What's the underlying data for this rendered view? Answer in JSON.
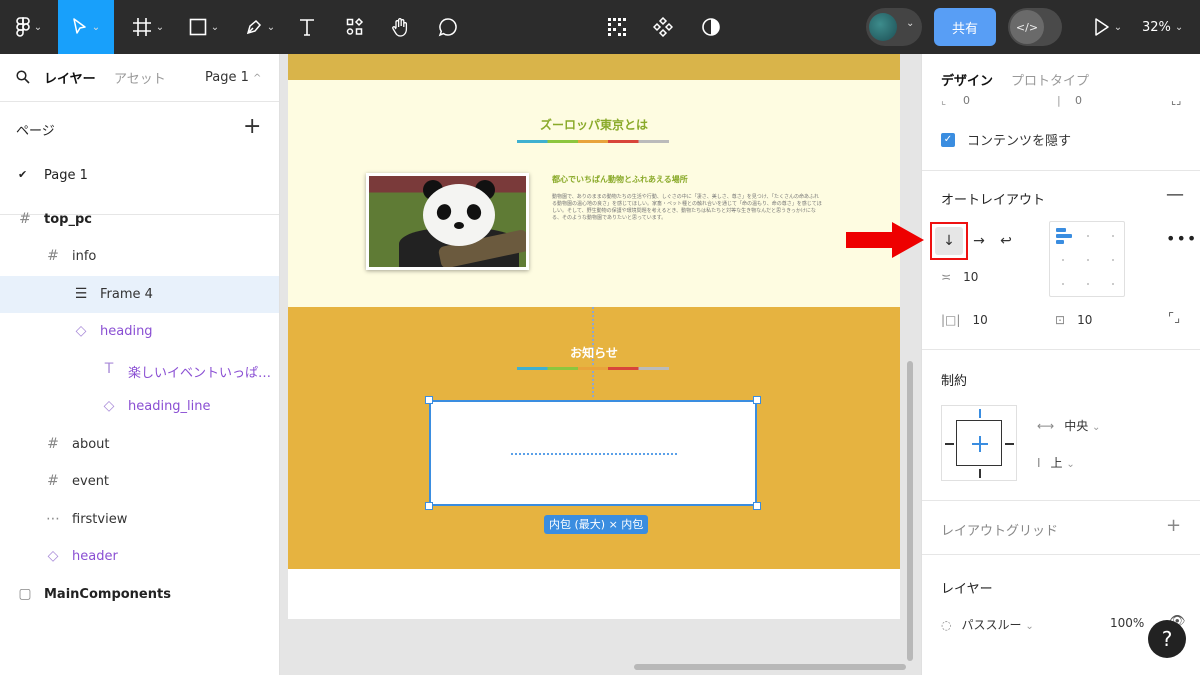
{
  "toolbar": {
    "share_label": "共有",
    "zoom_label": "32%",
    "colors": {
      "background": "#2c2c2c",
      "active_tool": "#18a0fb",
      "share": "#589ef5"
    }
  },
  "left_panel": {
    "tab_layers": "レイヤー",
    "tab_assets": "アセット",
    "page_selector": "Page 1",
    "pages_label": "ページ",
    "pages": [
      "Page 1"
    ],
    "layers": [
      {
        "name": "top_pc",
        "icon": "frame-icon",
        "depth": 0
      },
      {
        "name": "info",
        "icon": "frame-icon",
        "depth": 1
      },
      {
        "name": "Frame 4",
        "icon": "auto-layout-icon",
        "depth": 2,
        "selected": true
      },
      {
        "name": "heading",
        "icon": "component-instance-icon",
        "depth": 2
      },
      {
        "name": "楽しいイベントいっぱ…",
        "icon": "text-icon",
        "depth": 3
      },
      {
        "name": "heading_line",
        "icon": "component-instance-icon",
        "depth": 3
      },
      {
        "name": "about",
        "icon": "frame-icon",
        "depth": 1
      },
      {
        "name": "event",
        "icon": "frame-icon",
        "depth": 1
      },
      {
        "name": "firstview",
        "icon": "dashed-frame-icon",
        "depth": 1
      },
      {
        "name": "header",
        "icon": "component-instance-icon",
        "depth": 1
      },
      {
        "name": "MainComponents",
        "icon": "section-icon",
        "depth": 0
      }
    ]
  },
  "canvas": {
    "info_title": "ズーロッパ東京とは",
    "info_subtitle": "都心でいちばん動物とふれあえる場所",
    "info_body": "動物園で、ありのままの動物たちの生活や行動、しぐさの中に「凄さ、美しさ、尊さ」を見つけ、「たくさんの命あふれる動物園の温心地の良さ」を感じてほしい。家畜・ペット種との触れ合いを通じて「命の温もり、命の尊さ」を感じてほしい。そして、野生動物の保護や環境問題を考えるとき、動物たちは私たちと対等な生き物なんだと思うきっかけになる、そのような動物園でありたいと思っています。",
    "news_title": "お知らせ",
    "size_badge": "内包 (最大) × 内包"
  },
  "right_panel": {
    "tab_design": "デザイン",
    "tab_prototype": "プロトタイプ",
    "dim_values": [
      "0",
      "0"
    ],
    "clip_content_label": "コンテンツを隠す",
    "auto_layout_title": "オートレイアウト",
    "auto_layout": {
      "direction": "vertical",
      "gap": "10",
      "padding_horizontal": "10",
      "padding_vertical": "10"
    },
    "constraints_title": "制約",
    "constraint_horizontal": "中央",
    "constraint_vertical": "上",
    "layout_grid_title": "レイアウトグリッド",
    "layer_title": "レイヤー",
    "blend_mode": "パススルー",
    "opacity": "100%",
    "help_label": "?"
  },
  "annotation": {
    "arrow_color": "#ee0000"
  }
}
